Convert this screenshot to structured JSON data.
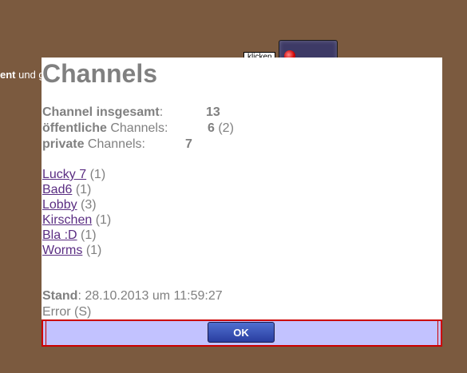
{
  "background": {
    "text_bold": "ent",
    "text_rest": " und g"
  },
  "widget": {
    "tooltip": "klicken"
  },
  "dialog": {
    "title": "Channels",
    "stats": {
      "total_label": "Channel insgesamt",
      "total_colon": ":",
      "total_value": "13",
      "public_label_bold": "öffentliche",
      "public_label_rest": " Channels:",
      "public_value": "6",
      "public_extra": " (2)",
      "private_label_bold": "private",
      "private_label_rest": " Channels:",
      "private_value": "7"
    },
    "channels": [
      {
        "name": "Lucky 7",
        "count": " (1)"
      },
      {
        "name": "Bad6",
        "count": " (1)"
      },
      {
        "name": "Lobby",
        "count": " (3)"
      },
      {
        "name": "Kirschen",
        "count": " (1)"
      },
      {
        "name": "Bla :D",
        "count": " (1)"
      },
      {
        "name": "Worms",
        "count": " (1)"
      }
    ],
    "stand_label": "Stand",
    "stand_value": ": 28.10.2013 um 11:59:27",
    "error_text": "Error (S)",
    "ok_label": "OK"
  },
  "colors": {
    "page_background": "#7b5a3f",
    "dialog_background": "#ffffff",
    "text_gray": "#808080",
    "link_purple": "#5a2d82",
    "footer_background": "#c2c2ff",
    "footer_border": "#cc0000",
    "button_blue": "#2a3ea0"
  }
}
